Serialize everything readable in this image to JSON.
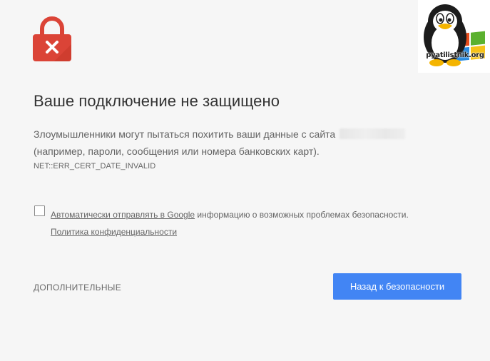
{
  "page": {
    "title": "Ваше подключение не защищено",
    "description_line1": "Злоумышленники могут пытаться похитить ваши данные с сайта",
    "description_line2": "(например, пароли, сообщения или номера банковских карт).",
    "error_code": "NET::ERR_CERT_DATE_INVALID"
  },
  "report": {
    "checkbox_checked": false,
    "link_text": "Автоматически отправлять в Google",
    "rest_text": " информацию о возможных проблемах безопасности.",
    "privacy_link": "Политика конфиденциальности"
  },
  "actions": {
    "details_label": "ДОПОЛНИТЕЛЬНЫЕ",
    "back_button_label": "Назад к безопасности"
  },
  "icons": {
    "warning": "lock-error-icon",
    "watermark": "pyatilistnik-logo"
  },
  "watermark": {
    "text": "pyatilistnik.org"
  },
  "colors": {
    "background": "#f6f6f6",
    "lock_red": "#db4437",
    "button_blue": "#4285f4",
    "title_text": "#333333",
    "body_text": "#646464"
  }
}
